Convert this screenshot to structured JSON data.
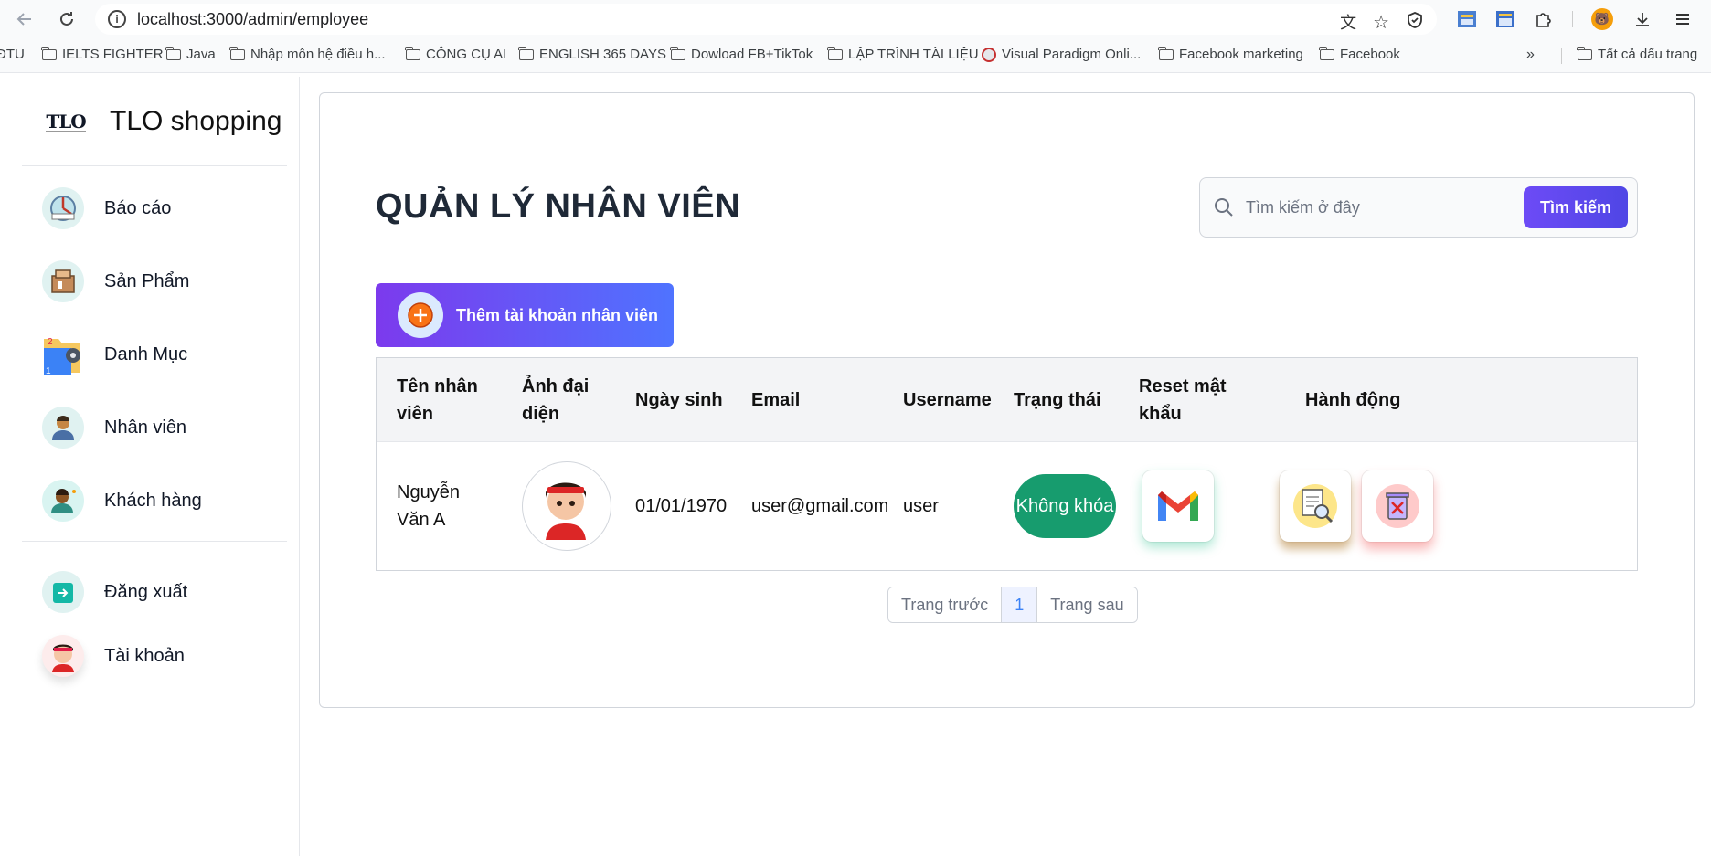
{
  "browser": {
    "url": "localhost:3000/admin/employee",
    "bookmarks": [
      "ĐTU",
      "IELTS FIGHTER",
      "Java",
      "Nhập môn hệ điều h...",
      "CÔNG CỤ AI",
      "ENGLISH 365 DAYS",
      "Dowload FB+TikTok",
      "LẬP TRÌNH TÀI LIỆU",
      "Visual Paradigm Onli...",
      "Facebook marketing",
      "Facebook"
    ],
    "all_bookmarks": "Tất cả dấu trang"
  },
  "sidebar": {
    "logo_text": "TLO",
    "brand": "TLO shopping",
    "items": [
      {
        "label": "Báo cáo",
        "icon": "report-icon"
      },
      {
        "label": "Sản Phẩm",
        "icon": "product-icon"
      },
      {
        "label": "Danh Mục",
        "icon": "category-icon"
      },
      {
        "label": "Nhân viên",
        "icon": "employee-icon"
      },
      {
        "label": "Khách hàng",
        "icon": "customer-icon"
      }
    ],
    "logout": "Đăng xuất",
    "account": "Tài khoản"
  },
  "main": {
    "title": "QUẢN LÝ NHÂN VIÊN",
    "search": {
      "placeholder": "Tìm kiếm ở đây",
      "button": "Tìm kiếm"
    },
    "add_button": "Thêm tài khoản nhân viên",
    "table": {
      "headers": [
        "Tên nhân viên",
        "Ảnh đại diện",
        "Ngày sinh",
        "Email",
        "Username",
        "Trạng thái",
        "Reset mật khẩu",
        "Hành động"
      ],
      "rows": [
        {
          "name": "Nguyễn Văn A",
          "dob": "01/01/1970",
          "email": "user@gmail.com",
          "username": "user",
          "status": "Không khóa"
        }
      ]
    },
    "pagination": {
      "prev": "Trang trước",
      "current": "1",
      "next": "Trang sau"
    }
  },
  "colors": {
    "accent": "#5b4bf5",
    "status_green": "#179c6e"
  }
}
